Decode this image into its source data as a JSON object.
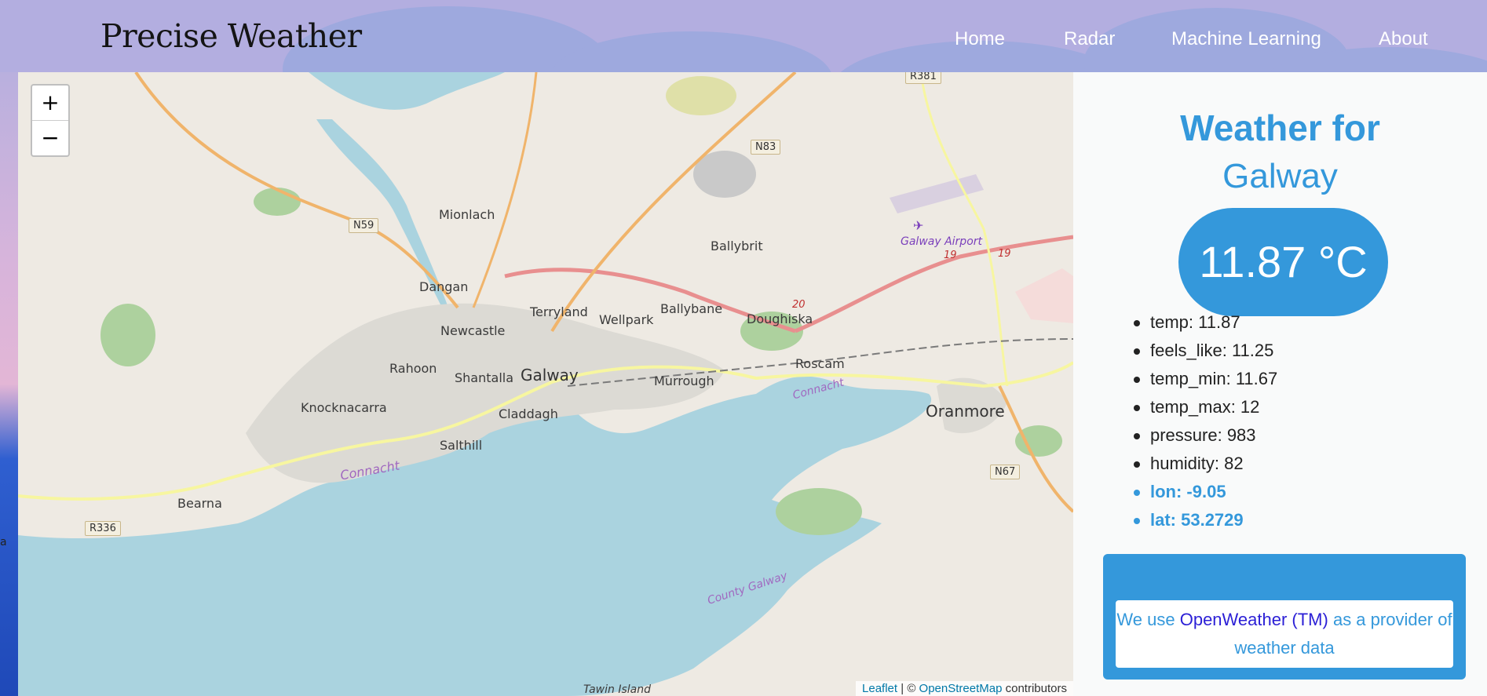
{
  "header": {
    "brand": "Precise Weather",
    "nav": [
      "Home",
      "Radar",
      "Machine Learning",
      "About"
    ]
  },
  "map": {
    "zoom_in": "+",
    "zoom_out": "−",
    "places": [
      "Mionlach",
      "Ballybrit",
      "Dangan",
      "Terryland",
      "Wellpark",
      "Ballybane",
      "Doughiska",
      "Newcastle",
      "Rahoon",
      "Shantalla",
      "Galway",
      "Murrough",
      "Roscam",
      "Knocknacarra",
      "Claddagh",
      "Oranmore",
      "Salthill",
      "Bearna",
      "Connacht",
      "Connacht",
      "County Galway",
      "Tawin Island"
    ],
    "roads": [
      "R381",
      "N83",
      "N59",
      "N67",
      "R336",
      "20",
      "19",
      "19"
    ],
    "airport": "Galway Airport",
    "attribution": {
      "leaflet": "Leaflet",
      "separator": "| ©",
      "osm": "OpenStreetMap",
      "contributors": "contributors"
    },
    "edge_char": "a"
  },
  "panel": {
    "title": "Weather for",
    "city": "Galway",
    "temperature": "11.87 °C",
    "stats": [
      "temp: 11.87",
      "feels_like: 11.25",
      "temp_min: 11.67",
      "temp_max: 12",
      "pressure: 983",
      "humidity: 82",
      "lon: -9.05",
      "lat: 53.2729"
    ],
    "provider": {
      "prefix": "We use",
      "link": "OpenWeather (TM)",
      "suffix": "as a provider of weather data"
    }
  },
  "colors": {
    "accent": "#3498db",
    "header": "#b3aee0",
    "sea": "#aad3df",
    "land": "#eeeae3"
  }
}
